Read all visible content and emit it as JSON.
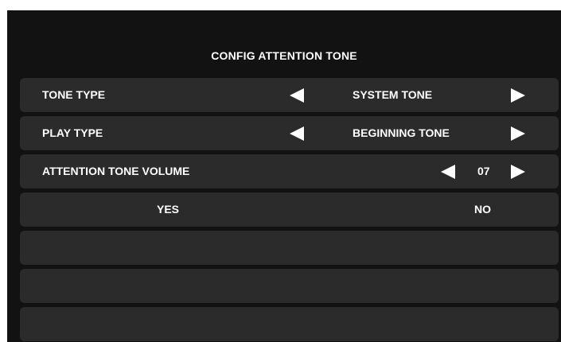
{
  "title": "CONFIG ATTENTION TONE",
  "rows": [
    {
      "label": "TONE TYPE",
      "value": "SYSTEM TONE"
    },
    {
      "label": "PLAY TYPE",
      "value": "BEGINNING TONE"
    },
    {
      "label": "ATTENTION TONE VOLUME",
      "value": "07"
    }
  ],
  "actions": {
    "yes_label": "YES",
    "no_label": "NO"
  },
  "icons": {
    "prev": "triangle-left-icon",
    "next": "triangle-right-icon"
  },
  "colors": {
    "background": "#121212",
    "row": "#2b2b2b",
    "text": "#ffffff"
  }
}
